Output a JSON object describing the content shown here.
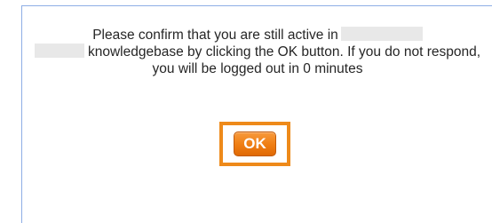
{
  "dialog": {
    "message_part1": "Please confirm that you are still active in",
    "message_part2": "knowledgebase by clicking the OK button. If you do not respond, you will be logged out in 0 minutes",
    "ok_label": "OK",
    "highlight_color": "#ee8a1a",
    "button_color": "#ef7d12",
    "border_color": "#8eaee5"
  }
}
